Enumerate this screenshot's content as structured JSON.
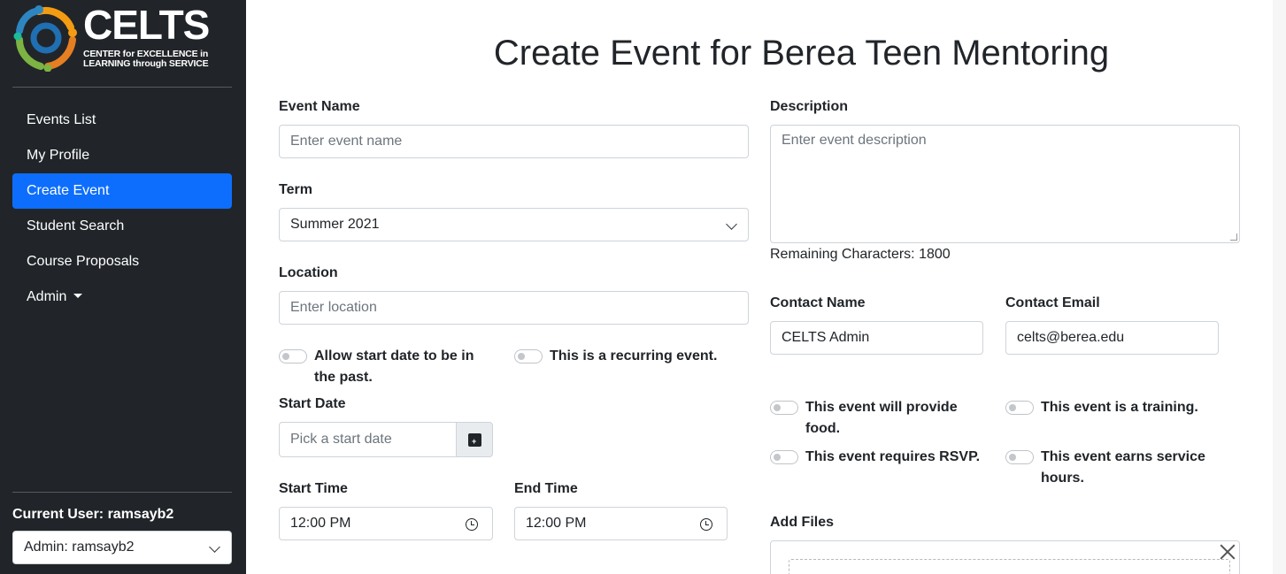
{
  "brand": {
    "title": "CELTS",
    "subtitle_line1": "CENTER for EXCELLENCE in",
    "subtitle_line2": "LEARNING through SERVICE",
    "colors": [
      "#f39c12",
      "#2e86c1",
      "#7cb342",
      "#1abc9c"
    ]
  },
  "sidebar": {
    "items": [
      {
        "label": "Events List",
        "active": false
      },
      {
        "label": "My Profile",
        "active": false
      },
      {
        "label": "Create Event",
        "active": true
      },
      {
        "label": "Student Search",
        "active": false
      },
      {
        "label": "Course Proposals",
        "active": false
      },
      {
        "label": "Admin",
        "active": false
      }
    ],
    "current_user": "Current User: ramsayb2",
    "user_select": "Admin: ramsayb2"
  },
  "page": {
    "title": "Create Event for Berea Teen Mentoring"
  },
  "form": {
    "event_name": {
      "label": "Event Name",
      "placeholder": "Enter event name"
    },
    "term": {
      "label": "Term",
      "value": "Summer 2021"
    },
    "location": {
      "label": "Location",
      "placeholder": "Enter location"
    },
    "toggles_left": [
      {
        "label": "Allow start date to be in the past."
      },
      {
        "label": "This is a recurring event."
      }
    ],
    "start_date": {
      "label": "Start Date",
      "placeholder": "Pick a start date"
    },
    "start_time": {
      "label": "Start Time",
      "value": "12:00 PM"
    },
    "end_time": {
      "label": "End Time",
      "value": "12:00 PM"
    },
    "description": {
      "label": "Description",
      "placeholder": "Enter event description"
    },
    "remaining": "Remaining Characters: 1800",
    "contact_name": {
      "label": "Contact Name",
      "value": "CELTS Admin"
    },
    "contact_email": {
      "label": "Contact Email",
      "value": "celts@berea.edu"
    },
    "toggles_right": [
      {
        "label": "This event will provide food."
      },
      {
        "label": "This event is a training."
      },
      {
        "label": "This event requires RSVP."
      },
      {
        "label": "This event earns service hours."
      }
    ],
    "add_files": {
      "label": "Add Files"
    }
  },
  "icons": {
    "calendar": "calendar-plus-icon",
    "clock": "clock-icon",
    "close": "close-icon",
    "chevron": "chevron-down-icon"
  },
  "colors": {
    "sidebar_bg": "#212529",
    "active": "#0d6efd"
  }
}
